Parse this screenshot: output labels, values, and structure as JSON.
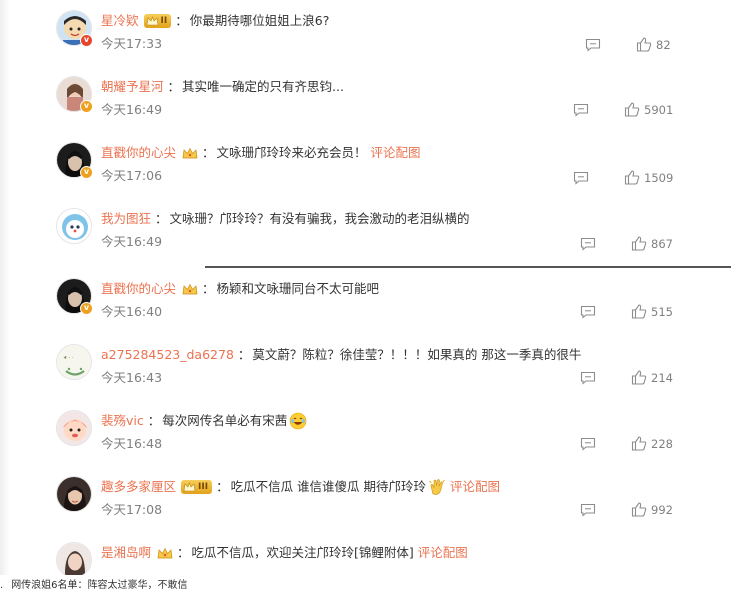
{
  "comments": [
    {
      "user": "星冷欵",
      "badge": "vip",
      "vip_level": "II",
      "text": "你最期待哪位姐姐上浪6?",
      "time": "今天17:33",
      "likes": "82",
      "verified": "red",
      "link": ""
    },
    {
      "user": "朝耀予星河",
      "badge": "",
      "text": "其实唯一确定的只有齐思钧...",
      "time": "今天16:49",
      "likes": "5901",
      "verified": "gold",
      "link": ""
    },
    {
      "user": "直戳你的心尖",
      "badge": "crown",
      "text": "文咏珊邝玲玲来必充会员！",
      "time": "今天17:06",
      "likes": "1509",
      "verified": "gold",
      "link": "评论配图"
    },
    {
      "user": "我为图狂",
      "badge": "",
      "text": "文咏珊？邝玲玲？有没有骗我，我会激动的老泪纵横的",
      "time": "今天16:49",
      "likes": "867",
      "verified": "",
      "link": ""
    },
    {
      "user": "直戳你的心尖",
      "badge": "crown",
      "text": "杨颖和文咏珊同台不太可能吧",
      "time": "今天16:40",
      "likes": "515",
      "verified": "gold",
      "link": ""
    },
    {
      "user": "a275284523_da6278",
      "badge": "",
      "text": "莫文蔚？陈粒？徐佳莹？！！！如果真的 那这一季真的很牛",
      "time": "今天16:43",
      "likes": "214",
      "verified": "",
      "link": ""
    },
    {
      "user": "裴殇vic",
      "badge": "",
      "text": "每次网传名单必有宋茜",
      "time": "今天16:48",
      "likes": "228",
      "verified": "",
      "link": "",
      "emoji": "laugh-emoji"
    },
    {
      "user": "趣多多家厘区",
      "badge": "vip",
      "vip_level": "III",
      "text": "吃瓜不信瓜 谁信谁傻瓜 期待邝玲玲",
      "time": "今天17:08",
      "likes": "992",
      "verified": "",
      "link": "评论配图",
      "emoji": "clap-emoji"
    },
    {
      "user": "是湘岛啊",
      "badge": "crown",
      "text": "吃瓜不信瓜，欢迎关注邝玲玲[锦鲤附体]",
      "time": "",
      "likes": "",
      "verified": "",
      "link": "评论配图"
    }
  ],
  "caption": {
    "bullet": ".",
    "text": "网传浪姐6名单：阵容太过豪华，不敢信"
  },
  "colors": {
    "username": "#eb7350",
    "time": "#808080",
    "text": "#333333"
  },
  "icons": {
    "reply": "comment-reply-icon",
    "like": "thumbs-up-icon"
  }
}
